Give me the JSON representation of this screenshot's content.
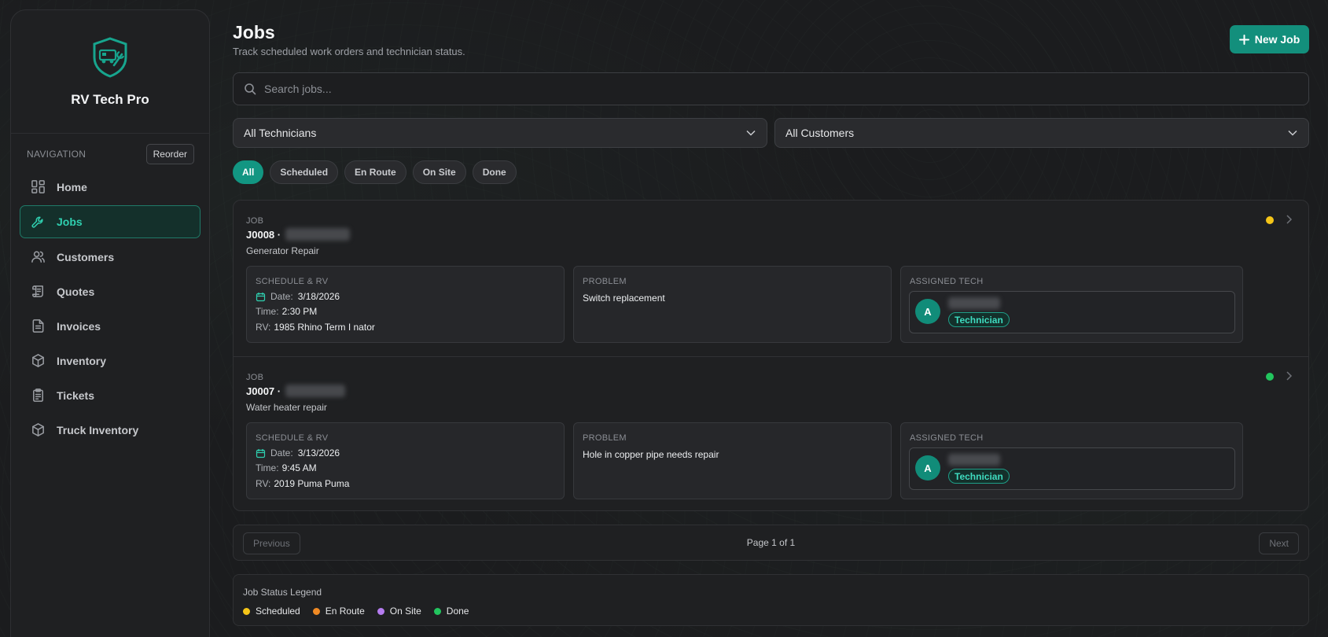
{
  "app": {
    "name": "RV Tech Pro"
  },
  "sidebar": {
    "section_label": "NAVIGATION",
    "reorder_label": "Reorder",
    "items": [
      {
        "label": "Home",
        "icon": "dashboard-icon"
      },
      {
        "label": "Jobs",
        "icon": "wrench-icon",
        "active": true
      },
      {
        "label": "Customers",
        "icon": "users-icon"
      },
      {
        "label": "Quotes",
        "icon": "scroll-icon"
      },
      {
        "label": "Invoices",
        "icon": "file-text-icon"
      },
      {
        "label": "Inventory",
        "icon": "box-icon"
      },
      {
        "label": "Tickets",
        "icon": "clipboard-icon"
      },
      {
        "label": "Truck Inventory",
        "icon": "box-icon"
      }
    ]
  },
  "header": {
    "title": "Jobs",
    "subtitle": "Track scheduled work orders and technician status.",
    "new_job_label": "New Job"
  },
  "search": {
    "placeholder": "Search jobs...",
    "value": ""
  },
  "filters": {
    "technician": "All Technicians",
    "customer": "All Customers"
  },
  "status_chips": [
    {
      "label": "All",
      "active": true
    },
    {
      "label": "Scheduled"
    },
    {
      "label": "En Route"
    },
    {
      "label": "On Site"
    },
    {
      "label": "Done"
    }
  ],
  "jobs": [
    {
      "kicker": "JOB",
      "id": "J0008 ·",
      "title": "Generator Repair",
      "status_color": "#f5c518",
      "schedule_label": "SCHEDULE & RV",
      "date_label": "Date:",
      "date": "3/18/2026",
      "time_label": "Time:",
      "time": "2:30 PM",
      "rv_label": "RV:",
      "rv": "1985 Rhino Term I nator",
      "problem_label": "PROBLEM",
      "problem": "Switch replacement",
      "tech_label": "ASSIGNED TECH",
      "tech_initial": "A",
      "tech_role": "Technician"
    },
    {
      "kicker": "JOB",
      "id": "J0007 ·",
      "title": "Water heater repair",
      "status_color": "#22c55e",
      "schedule_label": "SCHEDULE & RV",
      "date_label": "Date:",
      "date": "3/13/2026",
      "time_label": "Time:",
      "time": "9:45 AM",
      "rv_label": "RV:",
      "rv": "2019 Puma Puma",
      "problem_label": "PROBLEM",
      "problem": "Hole in copper pipe needs repair",
      "tech_label": "ASSIGNED TECH",
      "tech_initial": "A",
      "tech_role": "Technician"
    }
  ],
  "pagination": {
    "previous": "Previous",
    "page_text": "Page 1 of 1",
    "next": "Next"
  },
  "legend": {
    "title": "Job Status Legend",
    "items": [
      {
        "label": "Scheduled",
        "color": "#f5c518"
      },
      {
        "label": "En Route",
        "color": "#f08a24"
      },
      {
        "label": "On Site",
        "color": "#b57cf0"
      },
      {
        "label": "Done",
        "color": "#22c55e"
      }
    ]
  },
  "colors": {
    "accent": "#138f7c",
    "background": "#1b1c1e"
  }
}
